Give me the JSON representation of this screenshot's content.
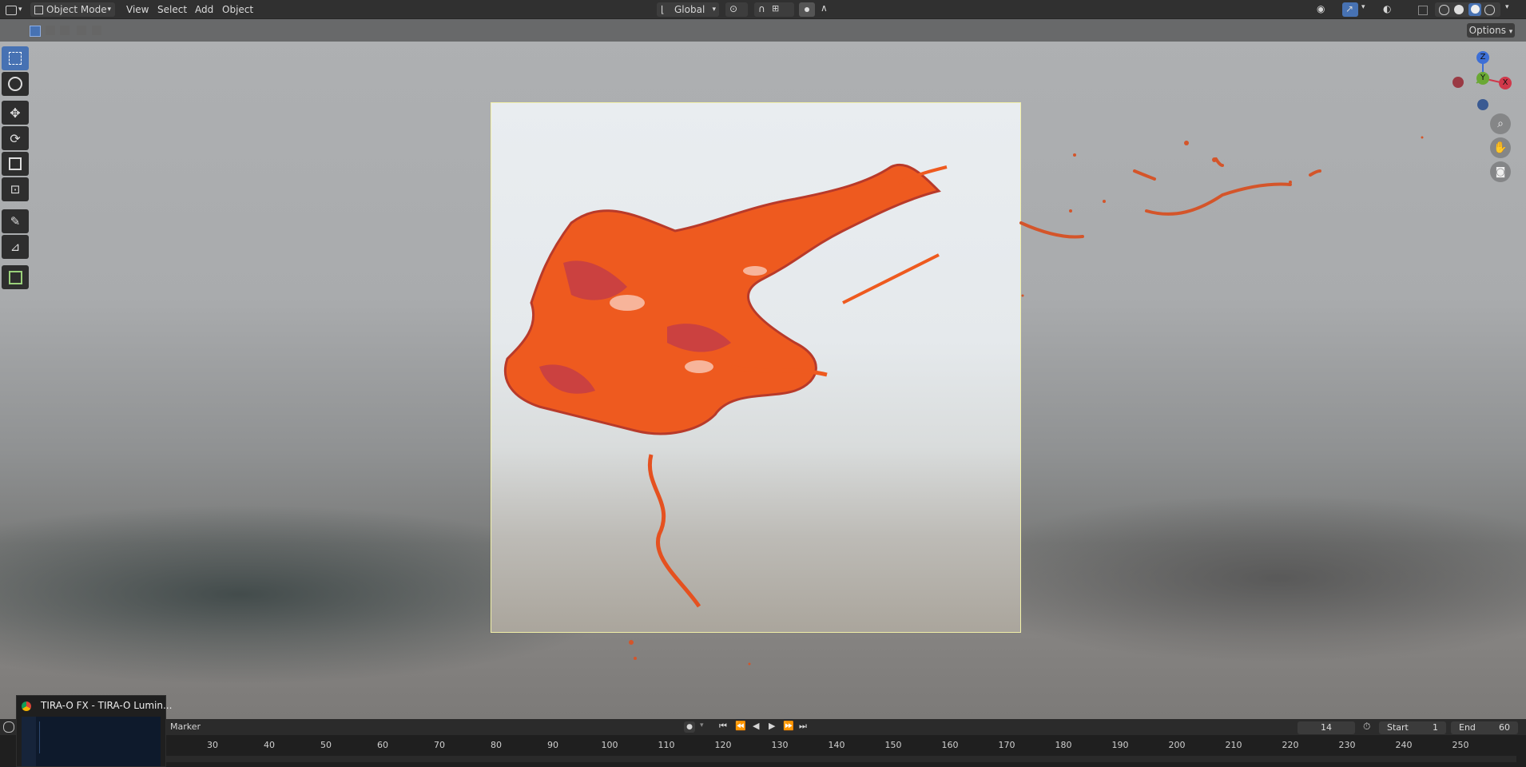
{
  "header": {
    "mode_label": "Object Mode",
    "menus": [
      "View",
      "Select",
      "Add",
      "Object"
    ],
    "transform_orientation": "Global"
  },
  "subbar": {
    "options_label": "Options"
  },
  "gizmo": {
    "axis_z": "Z",
    "axis_x": "X",
    "axis_y": "Y",
    "color_z": "#3d6fd6",
    "color_x": "#d0384a",
    "color_y": "#6aa834"
  },
  "toolbar": {
    "tools": [
      "select-box",
      "cursor",
      "move",
      "rotate",
      "scale",
      "transform",
      "annotate",
      "measure",
      "add-cube"
    ],
    "active_color": "#4772b3"
  },
  "timeline": {
    "marker_label": "Marker",
    "current_frame": "14",
    "start_label": "Start",
    "start_value": "1",
    "end_label": "End",
    "end_value": "60",
    "ruler_ticks": [
      "30",
      "40",
      "50",
      "60",
      "70",
      "80",
      "90",
      "100",
      "110",
      "120",
      "130",
      "140",
      "150",
      "160",
      "170",
      "180",
      "190",
      "200",
      "210",
      "220",
      "230",
      "240",
      "250"
    ]
  },
  "taskbar_popup": {
    "title": "TIRA-O FX - TIRA-O Lumin..."
  },
  "colors": {
    "splash_orange": "#ee5a1f",
    "splash_dark": "#b83a2a",
    "camera_border": "#f2f0a8"
  }
}
